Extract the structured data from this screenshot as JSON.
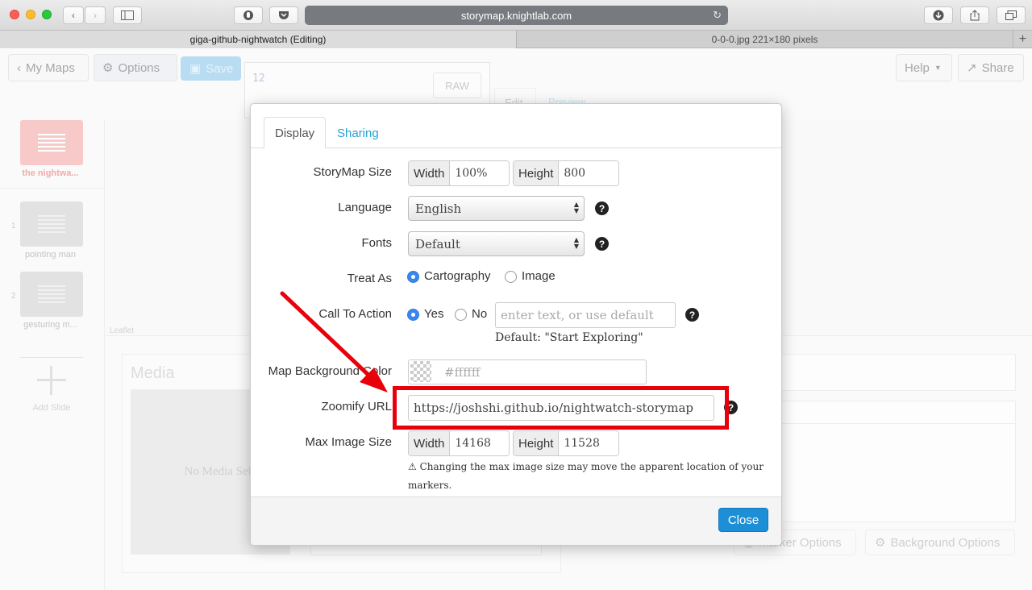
{
  "browser": {
    "url": "storymap.knightlab.com",
    "tabs": [
      {
        "title": "giga-github-nightwatch (Editing)"
      },
      {
        "title": "0-0-0.jpg 221×180 pixels"
      }
    ]
  },
  "toolbar": {
    "my_maps": "My Maps",
    "options": "Options",
    "save": "Save",
    "help": "Help",
    "share": "Share",
    "raw": "RAW",
    "json_line": "12",
    "edit_tab": "Edit",
    "preview_tab": "Preview"
  },
  "sidebar": {
    "slides": [
      {
        "num": "",
        "label": "the nightwa..."
      },
      {
        "num": "1",
        "label": "pointing man"
      },
      {
        "num": "2",
        "label": "gesturing m..."
      }
    ],
    "add_slide": "Add Slide"
  },
  "editor": {
    "leaflet": "Leaflet",
    "media_title": "Media",
    "media_placeholder": "No Media Selected",
    "marker_options": "Marker Options",
    "background_options": "Background Options"
  },
  "modal": {
    "tabs": [
      {
        "label": "Display"
      },
      {
        "label": "Sharing"
      }
    ],
    "storymap_size": {
      "label": "StoryMap Size",
      "width_label": "Width",
      "width_value": "100%",
      "height_label": "Height",
      "height_value": "800"
    },
    "language": {
      "label": "Language",
      "value": "English"
    },
    "fonts": {
      "label": "Fonts",
      "value": "Default"
    },
    "treat_as": {
      "label": "Treat As",
      "option1": "Cartography",
      "option2": "Image",
      "selected": "Cartography"
    },
    "call_to_action": {
      "label": "Call To Action",
      "option1": "Yes",
      "option2": "No",
      "selected": "Yes",
      "placeholder": "enter text, or use default",
      "default_note": "Default: \"Start Exploring\""
    },
    "map_background": {
      "label": "Map Background Color",
      "value": "#ffffff"
    },
    "zoomify_url": {
      "label": "Zoomify URL",
      "value": "https://joshshi.github.io/nightwatch-storymap"
    },
    "max_image_size": {
      "label": "Max Image Size",
      "width_label": "Width",
      "width_value": "14168",
      "height_label": "Height",
      "height_value": "11528",
      "warning": "Changing the max image size may move the apparent location of your markers."
    },
    "close": "Close"
  },
  "colors": {
    "accent": "#1d8fd6",
    "link": "#2a9fd0",
    "annotation": "#e8000b",
    "radio_checked": "#3a86f0"
  }
}
